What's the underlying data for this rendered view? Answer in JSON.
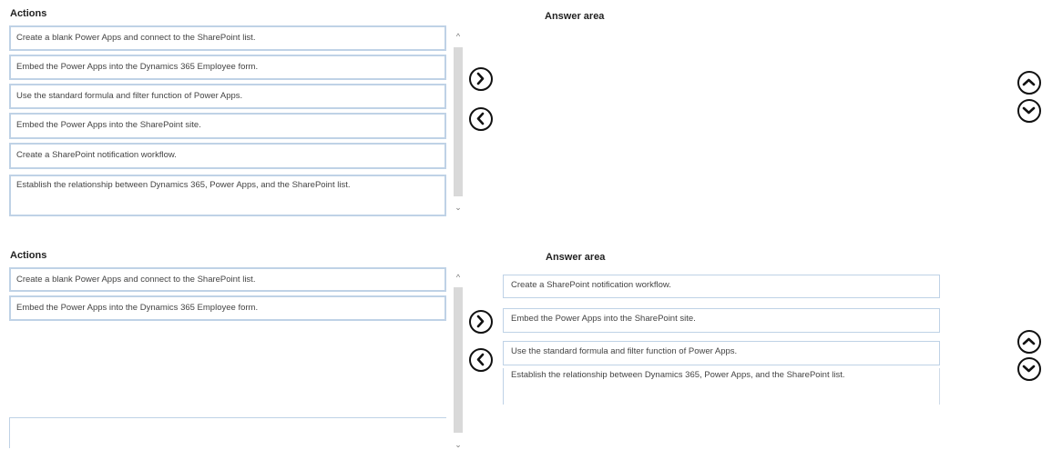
{
  "panel_1": {
    "actions_heading": "Actions",
    "answer_heading": "Answer area",
    "actions": [
      "Create a blank Power Apps and connect to the SharePoint list.",
      "Embed the Power Apps into the Dynamics 365 Employee form.",
      "Use the standard formula and filter function of Power Apps.",
      "Embed the Power Apps into the SharePoint site.",
      "Create a SharePoint notification workflow.",
      "Establish the relationship between Dynamics 365, Power Apps, and the SharePoint list."
    ],
    "answers": []
  },
  "panel_2": {
    "actions_heading": "Actions",
    "answer_heading": "Answer area",
    "actions": [
      "Create a blank Power Apps and connect to the SharePoint list.",
      "Embed the Power Apps into the Dynamics 365 Employee form."
    ],
    "answers": [
      "Create a SharePoint notification workflow.",
      "Embed the Power Apps into the SharePoint site.",
      "Use the standard formula and filter function of Power Apps.",
      "Establish the relationship between Dynamics 365, Power Apps, and the SharePoint list."
    ]
  },
  "icons": {
    "move_right": "chevron-right-icon",
    "move_left": "chevron-left-icon",
    "move_up": "chevron-up-icon",
    "move_down": "chevron-down-icon",
    "scroll_up": "scroll-up-arrow",
    "scroll_down": "scroll-down-arrow"
  },
  "colors": {
    "item_border": "#bfd2e6",
    "button_border": "#111111",
    "scroll_thumb": "#d9d9d9"
  }
}
